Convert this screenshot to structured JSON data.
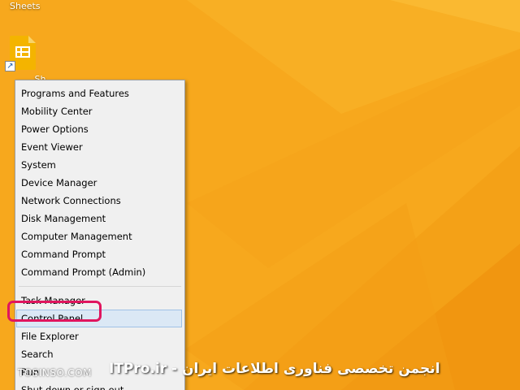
{
  "desktop": {
    "background_color": "#f7a81d",
    "icon_label_top": "Sheets",
    "icon_label_bottom": "...Sh...",
    "icon": "google-sheets-icon"
  },
  "context_menu": {
    "items": [
      {
        "label": "Programs and Features"
      },
      {
        "label": "Mobility Center"
      },
      {
        "label": "Power Options"
      },
      {
        "label": "Event Viewer"
      },
      {
        "label": "System"
      },
      {
        "label": "Device Manager"
      },
      {
        "label": "Network Connections"
      },
      {
        "label": "Disk Management"
      },
      {
        "label": "Computer Management"
      },
      {
        "label": "Command Prompt"
      },
      {
        "label": "Command Prompt (Admin)"
      },
      {
        "label": "Task Manager"
      },
      {
        "label": "Control Panel",
        "selected": true
      },
      {
        "label": "File Explorer"
      },
      {
        "label": "Search"
      },
      {
        "label": "Run"
      },
      {
        "label": "Shut down or sign out"
      }
    ],
    "highlight_color": "#e0155e"
  },
  "watermark": {
    "site": "TOSINSO.COM",
    "text": "ITPro.ir - انجمن تخصصی فناوری اطلاعات ایران"
  }
}
